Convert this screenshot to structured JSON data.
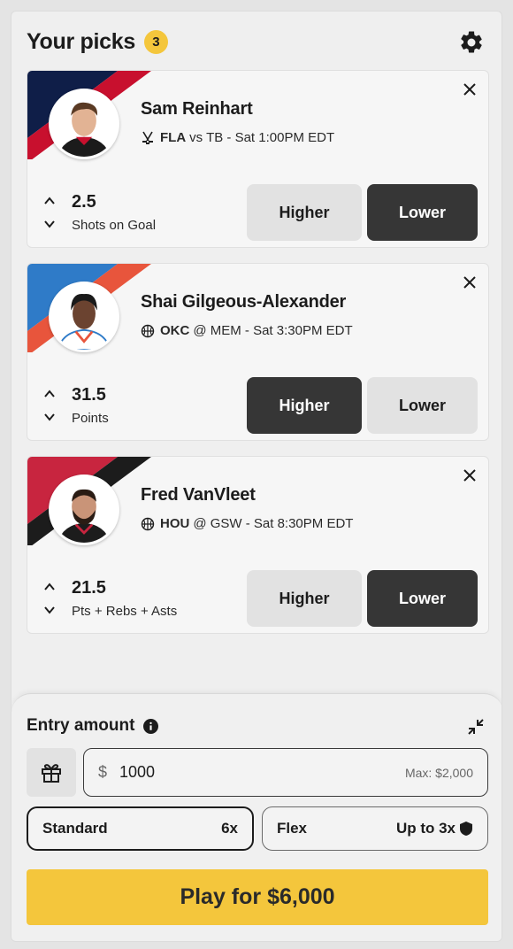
{
  "header": {
    "title": "Your picks",
    "count": "3"
  },
  "picks": [
    {
      "name": "Sam Reinhart",
      "team": "FLA",
      "matchup": "vs TB - Sat 1:00PM EDT",
      "sport_icon": "hockey-sticks-icon",
      "line": "2.5",
      "stat": "Shots on Goal",
      "selected": "Lower",
      "stripe_colors": [
        "#0f1e48",
        "#c8102e"
      ]
    },
    {
      "name": "Shai Gilgeous-Alexander",
      "team": "OKC",
      "matchup": "@ MEM - Sat 3:30PM EDT",
      "sport_icon": "basketball-icon",
      "line": "31.5",
      "stat": "Points",
      "selected": "Higher",
      "stripe_colors": [
        "#2f7bc8",
        "#e8553c"
      ]
    },
    {
      "name": "Fred VanVleet",
      "team": "HOU",
      "matchup": "@ GSW - Sat 8:30PM EDT",
      "sport_icon": "basketball-icon",
      "line": "21.5",
      "stat": "Pts + Rebs + Asts",
      "selected": "Lower",
      "stripe_colors": [
        "#c8253f",
        "#1c1c1c"
      ]
    }
  ],
  "buttons": {
    "higher": "Higher",
    "lower": "Lower"
  },
  "entry": {
    "title": "Entry amount",
    "currency": "$",
    "amount": "1000",
    "max": "Max: $2,000",
    "modes": [
      {
        "label": "Standard",
        "multiplier": "6x",
        "selected": true
      },
      {
        "label": "Flex",
        "multiplier": "Up to 3x",
        "selected": false
      }
    ],
    "play_label": "Play for $6,000"
  },
  "colors": {
    "accent": "#f4c63c",
    "selected_button": "#363636",
    "unselected_button": "#e2e2e2"
  }
}
